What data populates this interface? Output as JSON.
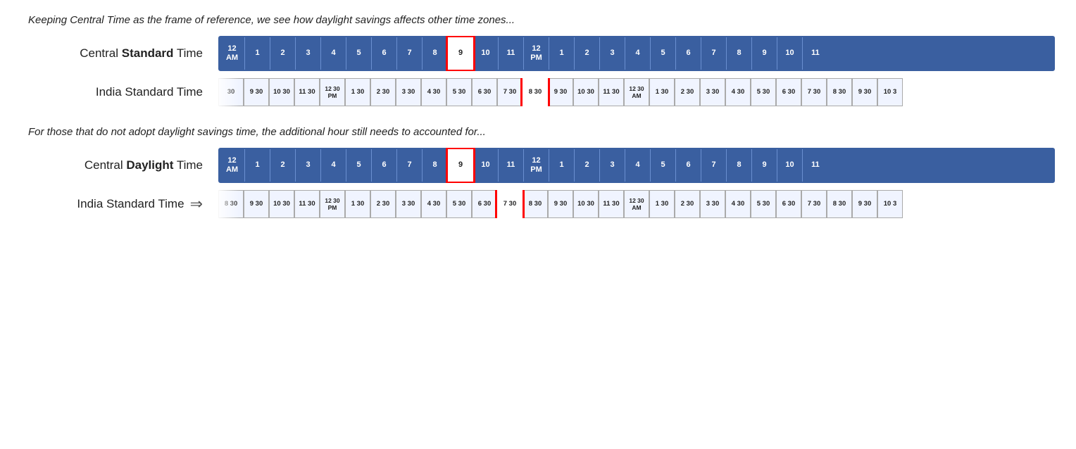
{
  "section1": {
    "caption": "Keeping Central Time as the frame of reference, we see how daylight savings affects other time zones...",
    "central_label_pre": "Central ",
    "central_label_bold": "Standard",
    "central_label_post": " Time",
    "india_label": "India Standard Time",
    "central_hours": [
      {
        "line1": "12",
        "line2": "AM"
      },
      {
        "line1": "1",
        "line2": ""
      },
      {
        "line1": "2",
        "line2": ""
      },
      {
        "line1": "3",
        "line2": ""
      },
      {
        "line1": "4",
        "line2": ""
      },
      {
        "line1": "5",
        "line2": ""
      },
      {
        "line1": "6",
        "line2": ""
      },
      {
        "line1": "7",
        "line2": ""
      },
      {
        "line1": "8",
        "line2": ""
      },
      {
        "line1": "9",
        "line2": "",
        "highlight": true
      },
      {
        "line1": "10",
        "line2": ""
      },
      {
        "line1": "11",
        "line2": ""
      },
      {
        "line1": "12",
        "line2": "PM"
      },
      {
        "line1": "1",
        "line2": ""
      },
      {
        "line1": "2",
        "line2": ""
      },
      {
        "line1": "3",
        "line2": ""
      },
      {
        "line1": "4",
        "line2": ""
      },
      {
        "line1": "5",
        "line2": ""
      },
      {
        "line1": "6",
        "line2": ""
      },
      {
        "line1": "7",
        "line2": ""
      },
      {
        "line1": "8",
        "line2": ""
      },
      {
        "line1": "9",
        "line2": ""
      },
      {
        "line1": "10",
        "line2": ""
      },
      {
        "line1": "11",
        "line2": ""
      }
    ],
    "india_hours_pre": [
      {
        "line1": "30",
        "line2": ""
      },
      {
        "line1": "9 30",
        "line2": ""
      },
      {
        "line1": "10 30",
        "line2": ""
      },
      {
        "line1": "11 30",
        "line2": ""
      }
    ],
    "india_hours_pm": [
      {
        "line1": "12 30",
        "line2": "PM"
      }
    ],
    "india_hours_mid": [
      {
        "line1": "1 30",
        "line2": ""
      },
      {
        "line1": "2 30",
        "line2": ""
      },
      {
        "line1": "3 30",
        "line2": ""
      },
      {
        "line1": "4 30",
        "line2": ""
      },
      {
        "line1": "5 30",
        "line2": ""
      },
      {
        "line1": "6 30",
        "line2": ""
      },
      {
        "line1": "7 30",
        "line2": ""
      },
      {
        "line1": "8 30",
        "line2": "",
        "highlight": true
      },
      {
        "line1": "9 30",
        "line2": ""
      },
      {
        "line1": "10 30",
        "line2": ""
      },
      {
        "line1": "11 30",
        "line2": ""
      }
    ],
    "india_hours_am": [
      {
        "line1": "12 30",
        "line2": "AM"
      }
    ],
    "india_hours_post": [
      {
        "line1": "1 30",
        "line2": ""
      },
      {
        "line1": "2 30",
        "line2": ""
      },
      {
        "line1": "3 30",
        "line2": ""
      },
      {
        "line1": "4 30",
        "line2": ""
      },
      {
        "line1": "5 30",
        "line2": ""
      },
      {
        "line1": "6 30",
        "line2": ""
      },
      {
        "line1": "7 30",
        "line2": ""
      },
      {
        "line1": "8 30",
        "line2": ""
      },
      {
        "line1": "9 30",
        "line2": ""
      },
      {
        "line1": "10 3",
        "line2": ""
      }
    ]
  },
  "section2": {
    "caption": "For those that do not adopt daylight savings time, the additional hour still needs to accounted for...",
    "central_label_pre": "Central ",
    "central_label_bold": "Daylight",
    "central_label_post": " Time",
    "india_label": "India Standard Time",
    "central_hours": [
      {
        "line1": "12",
        "line2": "AM"
      },
      {
        "line1": "1",
        "line2": ""
      },
      {
        "line1": "2",
        "line2": ""
      },
      {
        "line1": "3",
        "line2": ""
      },
      {
        "line1": "4",
        "line2": ""
      },
      {
        "line1": "5",
        "line2": ""
      },
      {
        "line1": "6",
        "line2": ""
      },
      {
        "line1": "7",
        "line2": ""
      },
      {
        "line1": "8",
        "line2": ""
      },
      {
        "line1": "9",
        "line2": "",
        "highlight": true
      },
      {
        "line1": "10",
        "line2": ""
      },
      {
        "line1": "11",
        "line2": ""
      },
      {
        "line1": "12",
        "line2": "PM"
      },
      {
        "line1": "1",
        "line2": ""
      },
      {
        "line1": "2",
        "line2": ""
      },
      {
        "line1": "3",
        "line2": ""
      },
      {
        "line1": "4",
        "line2": ""
      },
      {
        "line1": "5",
        "line2": ""
      },
      {
        "line1": "6",
        "line2": ""
      },
      {
        "line1": "7",
        "line2": ""
      },
      {
        "line1": "8",
        "line2": ""
      },
      {
        "line1": "9",
        "line2": ""
      },
      {
        "line1": "10",
        "line2": ""
      },
      {
        "line1": "11",
        "line2": ""
      }
    ]
  }
}
